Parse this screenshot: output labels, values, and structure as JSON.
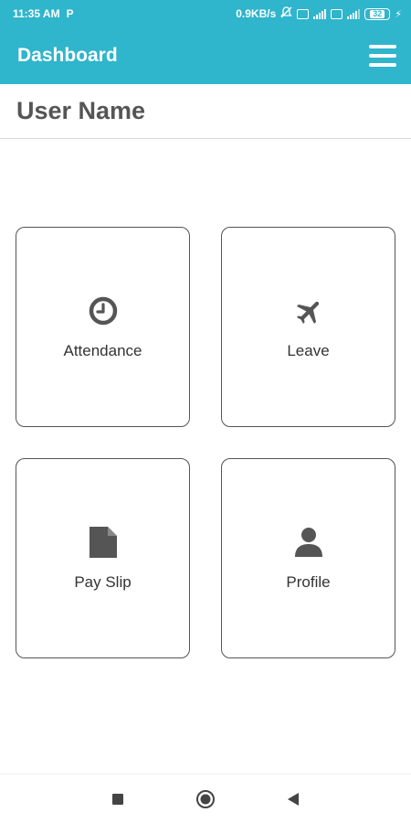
{
  "status_bar": {
    "time": "11:35 AM",
    "carrier_icon": "P",
    "network_speed": "0.9KB/s",
    "battery_level": "32",
    "icons": [
      "mute-icon",
      "volte-icon",
      "signal-icon",
      "volte-icon",
      "signal-icon",
      "battery-icon",
      "charging-icon"
    ]
  },
  "app_bar": {
    "title": "Dashboard",
    "menu_icon": "hamburger-menu-icon"
  },
  "user": {
    "name": "User Name"
  },
  "tiles": [
    {
      "label": "Attendance",
      "icon": "clock-icon"
    },
    {
      "label": "Leave",
      "icon": "airplane-icon"
    },
    {
      "label": "Pay Slip",
      "icon": "document-icon"
    },
    {
      "label": "Profile",
      "icon": "person-icon"
    }
  ],
  "nav_bar": {
    "buttons": [
      "recent-apps-icon",
      "home-icon",
      "back-icon"
    ]
  },
  "colors": {
    "primary": "#2fb5cc",
    "icon": "#555555",
    "text": "#333333"
  }
}
